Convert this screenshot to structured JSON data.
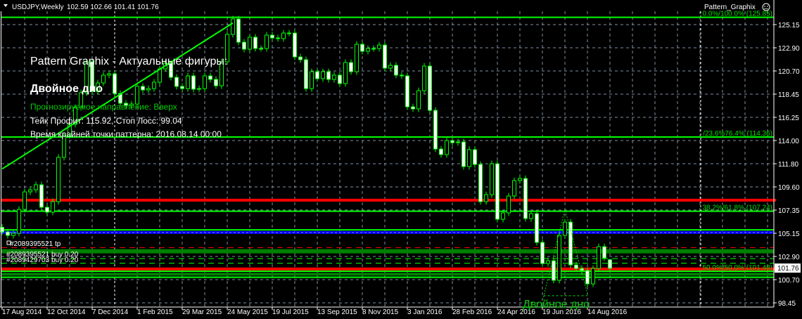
{
  "header": {
    "symbol": "USDJPY,Weekly",
    "ohlc": "102.59 102.66 101.41 101.76",
    "indicator_name": "Pattern_Graphix"
  },
  "overlay": {
    "title": "Pattern Graphix - Актуальные фигуры:",
    "pattern_name": "Двойное дно",
    "direction": "Прогнозируемое направление: Вверх",
    "targets": "Тейк Профит: 115.92, Стоп Лосс: 99.04",
    "pattern_time": "Время крайней точки паттерна: 2016.08.14 00:00",
    "chart_pattern_label": "Двойное дно"
  },
  "orders": {
    "tp": "#2089395521 tp",
    "buy1": "#2089395521 buy 0.20",
    "buy2": "#2089429703 buy 0.20"
  },
  "current_price": "101.76",
  "colors": {
    "bull_outline": "#00ff00",
    "bear_fill": "#ffffff",
    "grid": "#8090a0",
    "fibo": "#00ff00",
    "red_level": "#ff0000",
    "blue_level": "#0000ff",
    "dark_green": "#008000"
  },
  "chart_data": {
    "type": "candlestick",
    "title": "USDJPY,Weekly",
    "ylim": [
      98.45,
      125.15
    ],
    "y_ticks": [
      "125.15",
      "122.90",
      "120.70",
      "118.45",
      "116.25",
      "114.00",
      "111.80",
      "109.60",
      "107.35",
      "105.15",
      "102.90",
      "100.70",
      "98.45"
    ],
    "x_ticks": [
      "17 Aug 2014",
      "12 Oct 2014",
      "7 Dec 2014",
      "1 Feb 2015",
      "29 Mar 2015",
      "24 May 2015",
      "19 Jul 2015",
      "13 Sep 2015",
      "8 Nov 2015",
      "3 Jan 2016",
      "28 Feb 2016",
      "24 Apr 2016",
      "19 Jun 2016",
      "14 Aug 2016"
    ],
    "first_open": 105.7,
    "close": [
      105.26,
      104.92,
      105.12,
      107.42,
      109.1,
      109.3,
      109.78,
      107.62,
      107.15,
      108.16,
      112.41,
      114.5,
      115.58,
      117.19,
      118.61,
      121.58,
      118.74,
      119.55,
      120.3,
      120.43,
      118.54,
      117.6,
      117.4,
      117.53,
      119.22,
      118.88,
      119.01,
      119.62,
      120.9,
      121.44,
      120.09,
      119.22,
      119.01,
      120.23,
      118.95,
      119.01,
      120.23,
      119.89,
      119.28,
      121.58,
      124.21,
      125.69,
      123.46,
      122.79,
      123.94,
      122.86,
      122.86,
      124.14,
      123.87,
      123.8,
      124.34,
      124.34,
      122.05,
      121.78,
      119.01,
      120.63,
      119.96,
      120.63,
      119.89,
      120.3,
      119.49,
      121.51,
      120.63,
      123.26,
      122.59,
      122.86,
      122.86,
      123.19,
      120.97,
      121.24,
      120.3,
      120.23,
      117.26,
      117.06,
      118.81,
      121.17,
      116.92,
      113.21,
      112.68,
      114.02,
      113.82,
      113.89,
      111.53,
      113.15,
      111.73,
      108.16,
      108.83,
      111.8,
      106.47,
      107.08,
      108.7,
      110.18,
      110.38,
      106.54,
      107.01,
      104.25,
      102.22,
      102.49,
      100.61,
      104.92,
      106.2,
      102.09,
      101.75,
      101.55,
      100.27,
      101.75,
      103.84,
      102.76,
      101.76
    ],
    "last_bar": {
      "open": 102.59,
      "high": 102.66,
      "low": 101.41,
      "close": 101.76
    },
    "fibo_levels": [
      {
        "price": 125.85,
        "label": "0.0%/100.0% (125.85)"
      },
      {
        "price": 114.36,
        "label": "/23.6%76.4% (114.36)"
      },
      {
        "price": 107.24,
        "label": "38.2%/61.8% (107.24)"
      },
      {
        "price": 101.48,
        "label": "50.0%/50.0% (101.48)"
      }
    ],
    "levels": [
      {
        "price": 108.3,
        "color": "red",
        "kind": "thick"
      },
      {
        "price": 105.45,
        "color": "green",
        "kind": "line"
      },
      {
        "price": 105.2,
        "color": "blue",
        "kind": "thick"
      },
      {
        "price": 103.75,
        "color": "red",
        "kind": "dashed"
      },
      {
        "price": 103.4,
        "color": "dark_green",
        "kind": "band"
      },
      {
        "price": 102.7,
        "color": "green",
        "kind": "dashed"
      },
      {
        "price": 102.25,
        "color": "green",
        "kind": "dashed"
      },
      {
        "price": 101.7,
        "color": "red",
        "kind": "thick"
      },
      {
        "price": 101.2,
        "color": "dark_green",
        "kind": "thick"
      },
      {
        "price": 100.9,
        "color": "green",
        "kind": "line"
      }
    ],
    "trendline": {
      "from": {
        "bar": 0,
        "price": 111.3
      },
      "to": {
        "bar": 41,
        "price": 125.3
      }
    },
    "double_bottom": [
      {
        "bar": 96.2,
        "price": 99.0
      },
      {
        "bar": 100,
        "price": 107.45
      },
      {
        "bar": 104,
        "price": 99.3
      }
    ]
  }
}
